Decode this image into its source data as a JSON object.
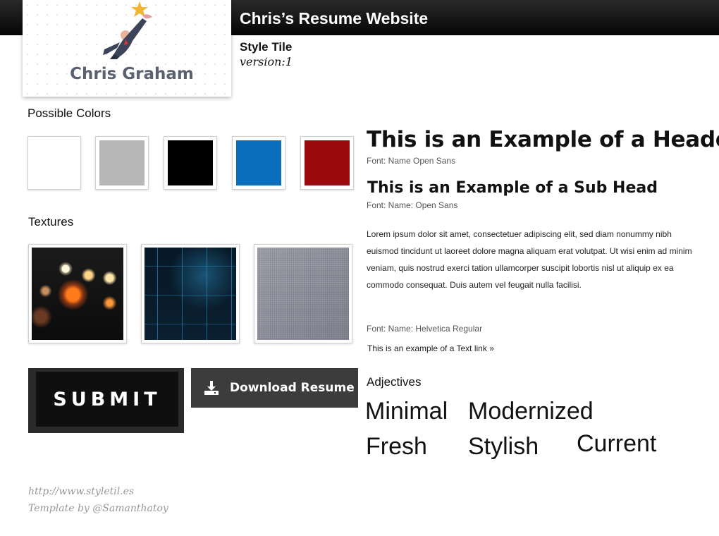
{
  "header": {
    "title": "Chris’s Resume Website",
    "tile_label": "Style Tile",
    "version": "version:1"
  },
  "logo": {
    "name": "Chris Graham",
    "icon": "businessman-reaching-star-icon"
  },
  "colors": {
    "label": "Possible Colors",
    "swatches": [
      "#FFFFFF",
      "#B7B7B7",
      "#000000",
      "#0A6EBD",
      "#9B0A0F"
    ]
  },
  "textures": {
    "label": "Textures",
    "items": [
      "bokeh-lights-texture",
      "circuit-board-texture",
      "gray-linen-texture"
    ]
  },
  "buttons": {
    "submit": "SUBMIT",
    "download": "Download Resume",
    "download_icon": "download-icon"
  },
  "typography": {
    "header_example": "This is an Example of a Header",
    "header_font": "Font: Name Open Sans",
    "subhead_example": "This is an Example of a Sub Head",
    "subhead_font": "Font: Name: Open Sans",
    "body_text": "Lorem ipsum dolor sit amet, consectetuer adipiscing elit, sed diam nonummy nibh euismod tincidunt ut laoreet dolore magna aliquam erat volutpat. Ut wisi enim ad minim veniam, quis nostrud exerci tation ullamcorper suscipit lobortis nisl ut aliquip ex ea commodo consequat. Duis autem vel feugait nulla facilisi.",
    "body_font": "Font: Name: Helvetica Regular",
    "text_link": "This is an example of a Text link »"
  },
  "adjectives": {
    "label": "Adjectives",
    "words": [
      "Minimal",
      "Modernized",
      "Fresh",
      "Stylish",
      "Current"
    ]
  },
  "footer": {
    "url": "http://www.styletil.es",
    "credit": "Template by @Samanthatoy"
  }
}
